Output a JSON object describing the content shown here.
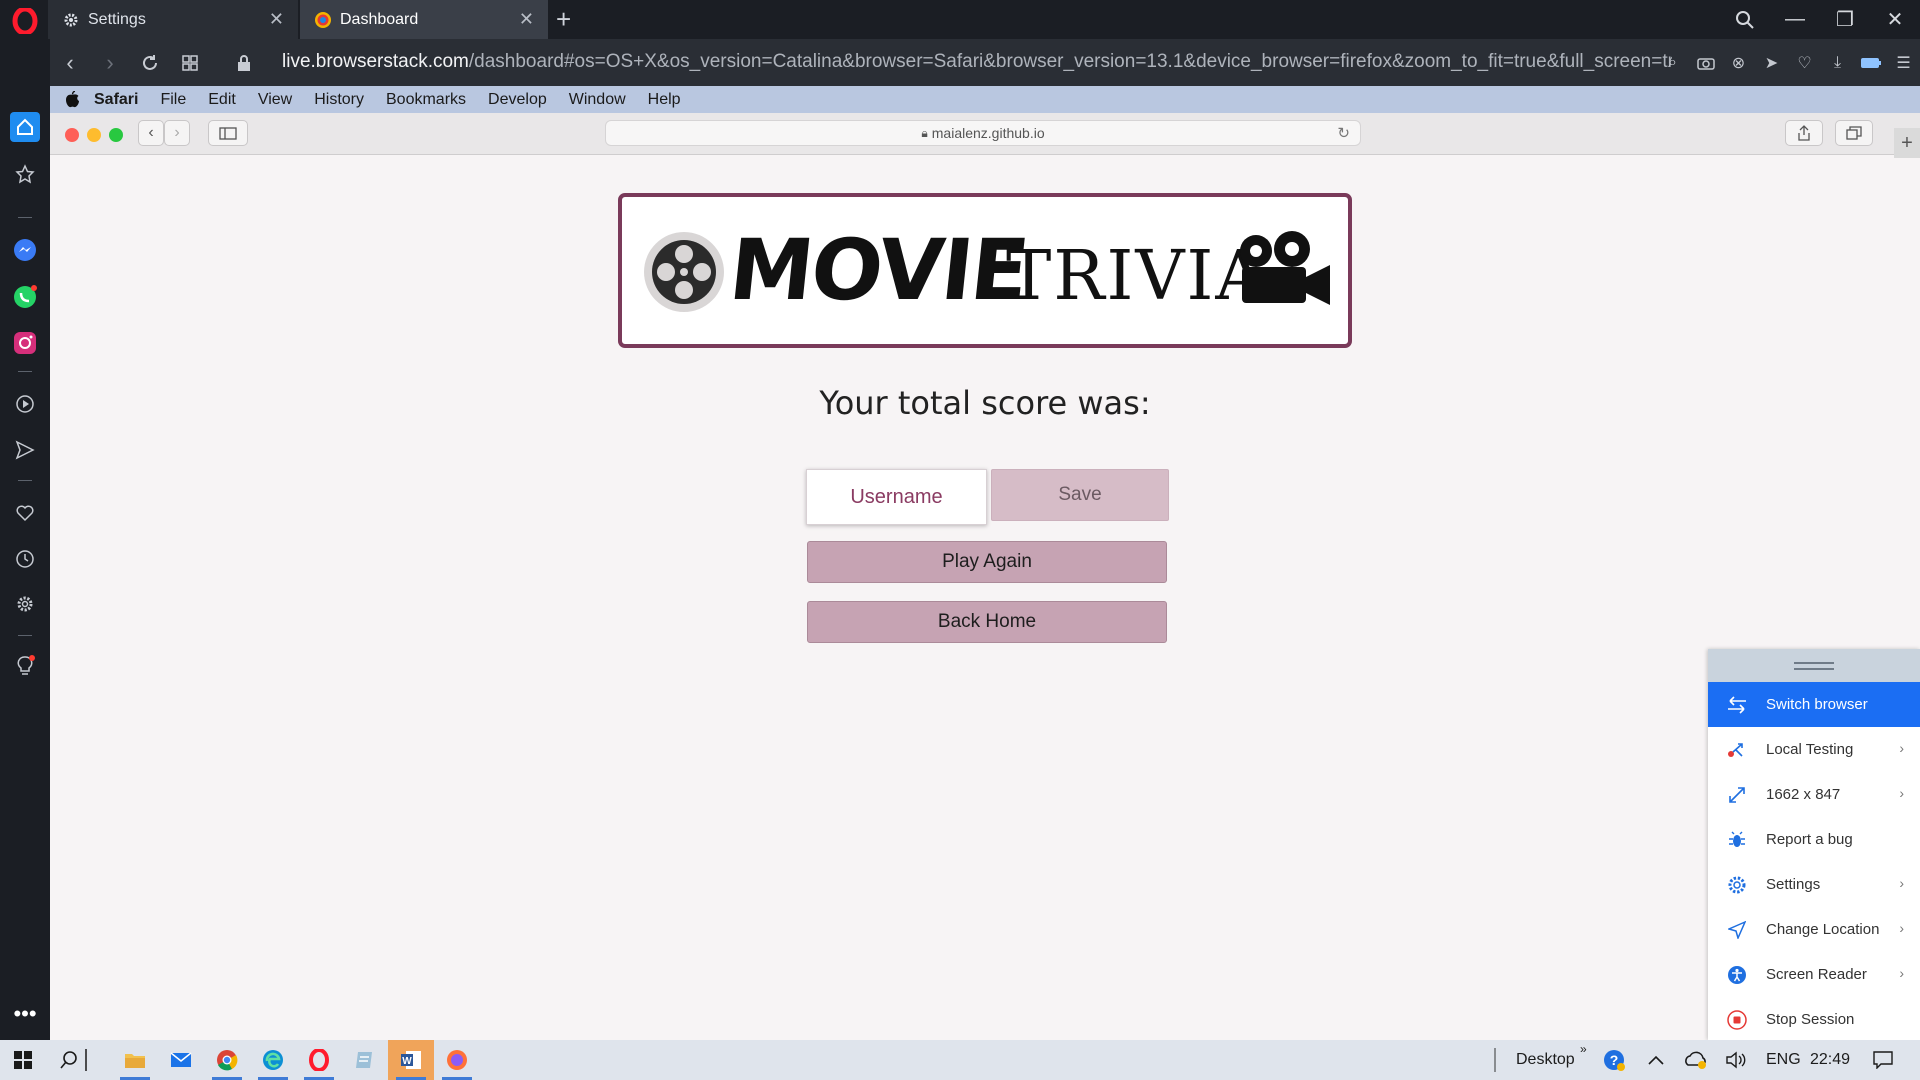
{
  "browser": {
    "tabs": [
      {
        "label": "Settings"
      },
      {
        "label": "Dashboard"
      }
    ],
    "url_host": "live.browserstack.com",
    "url_rest": "/dashboard#os=OS+X&os_version=Catalina&browser=Safari&browser_version=13.1&device_browser=firefox&zoom_to_fit=true&full_screen=true&ur"
  },
  "mac_menu": {
    "items": [
      "Safari",
      "File",
      "Edit",
      "View",
      "History",
      "Bookmarks",
      "Develop",
      "Window",
      "Help"
    ]
  },
  "safari": {
    "address": "maialenz.github.io"
  },
  "page": {
    "logo_title": "MOVIE",
    "logo_subtitle": "TRIVIA",
    "score_label": "Your total score was:",
    "username_placeholder": "Username",
    "save_label": "Save",
    "play_again_label": "Play Again",
    "back_home_label": "Back Home"
  },
  "bs_panel": {
    "items": [
      {
        "label": "Switch browser",
        "icon": "switch-icon"
      },
      {
        "label": "Local Testing",
        "icon": "local-testing-icon"
      },
      {
        "label": "1662 x 847",
        "icon": "resize-icon"
      },
      {
        "label": "Report a bug",
        "icon": "bug-icon"
      },
      {
        "label": "Settings",
        "icon": "gear-icon"
      },
      {
        "label": "Change Location",
        "icon": "location-arrow-icon"
      },
      {
        "label": "Screen Reader",
        "icon": "accessibility-icon"
      },
      {
        "label": "Stop Session",
        "icon": "stop-icon"
      }
    ]
  },
  "taskbar": {
    "desktop_label": "Desktop",
    "language": "ENG",
    "time": "22:49"
  },
  "colors": {
    "accent_blue": "#1b6ef3",
    "logo_border": "#7a3a5a",
    "button_pink": "#c6a3b3"
  }
}
